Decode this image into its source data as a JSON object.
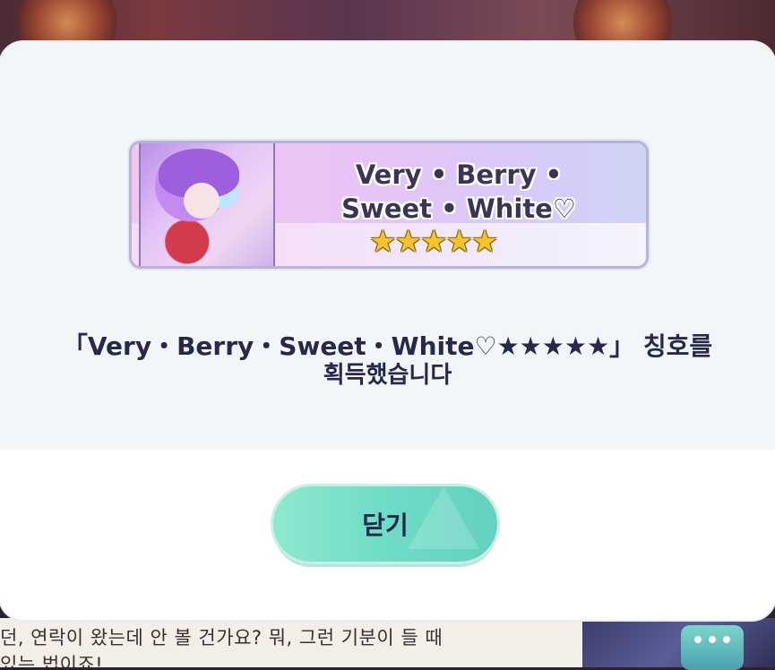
{
  "background": {
    "chat_line_1": "던, 연락이 왔는데 안 볼 건가요? 뭐, 그런 기분이 들 때",
    "chat_line_2": "있는 법이죠!"
  },
  "dialog": {
    "banner": {
      "title_line_1": "Very • Berry •",
      "title_line_2": "Sweet • White♡",
      "stars": "★★★★★",
      "rarity": 5
    },
    "message_line_1": "「Very・Berry・Sweet・White♡★★★★★」 칭호를",
    "message_line_2": "획득했습니다",
    "close_button_label": "닫기"
  },
  "colors": {
    "button_accent": "#6fdcc6",
    "text_dark": "#252a4a",
    "star_gold": "#f6c22d"
  }
}
